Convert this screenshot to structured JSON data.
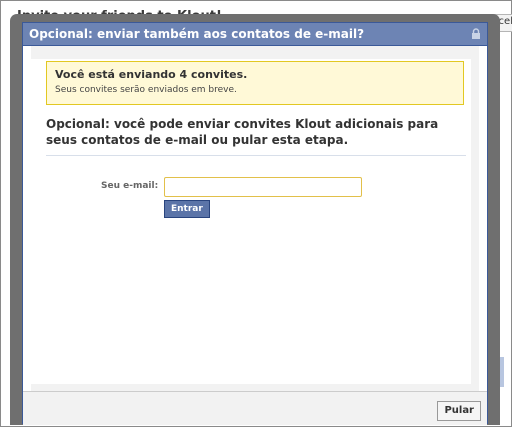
{
  "background": {
    "title": "Invite your friends to Klout!",
    "cancel_label": "Cancel"
  },
  "dialog": {
    "title": "Opcional: enviar também aos contatos de e-mail?",
    "notice": {
      "title": "Você está enviando 4 convites.",
      "subtitle": "Seus convites serão enviados em breve."
    },
    "heading": "Opcional: você pode enviar convites Klout adicionais para seus contatos de e-mail ou pular esta etapa.",
    "email_label": "Seu e-mail:",
    "email_value": "",
    "enter_label": "Entrar",
    "skip_label": "Pular"
  },
  "colors": {
    "header_bg": "#6d84b4",
    "notice_bg": "#fff9d7",
    "notice_border": "#e2c822",
    "button_bg": "#5b74a8"
  },
  "icons": {
    "header": "lock-icon"
  }
}
